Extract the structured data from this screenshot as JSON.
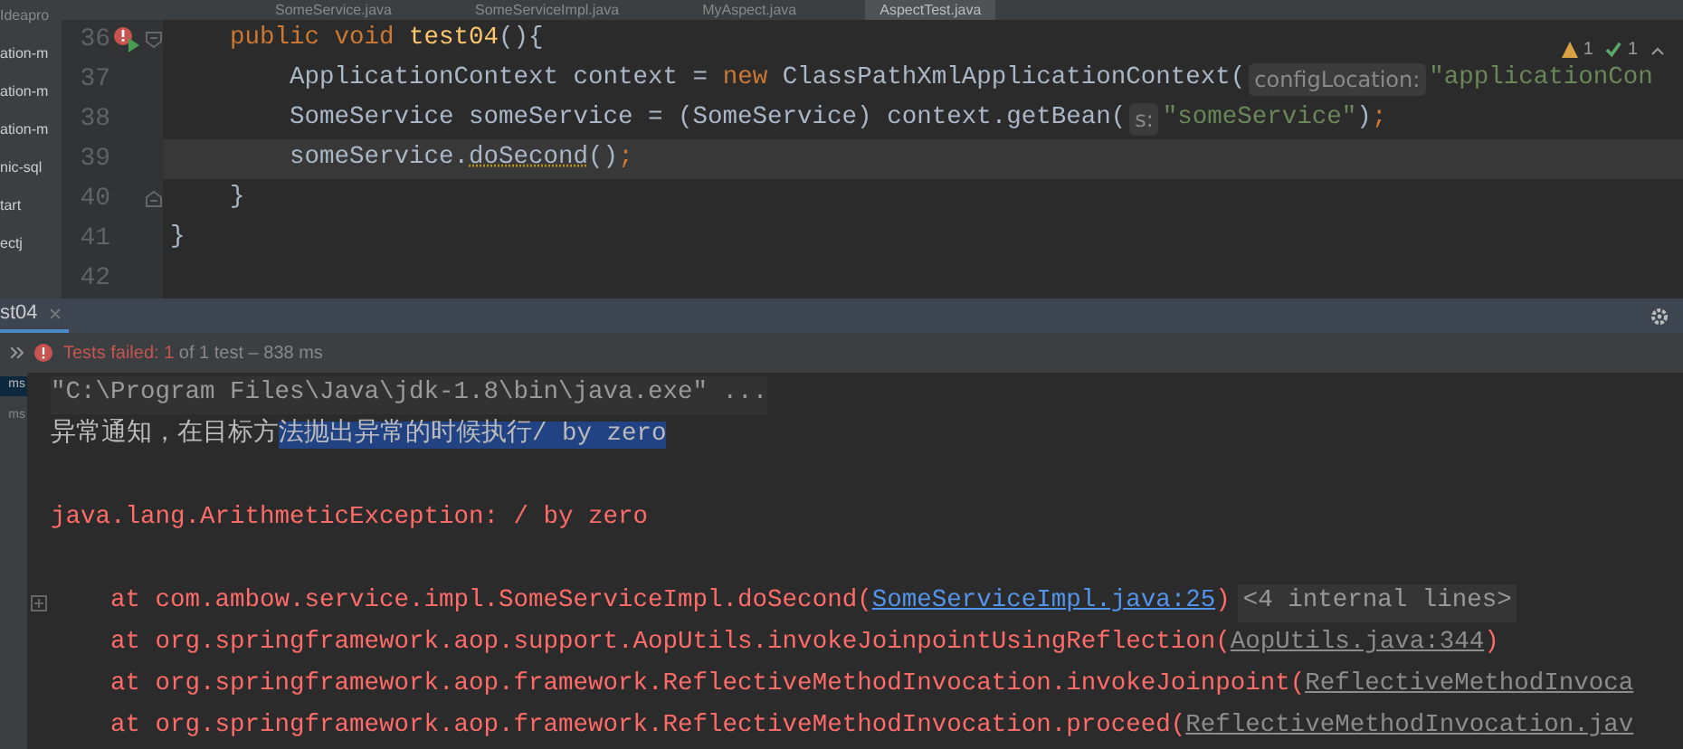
{
  "editor_tabs": [
    {
      "label": "SomeService.java",
      "selected": false
    },
    {
      "label": "SomeServiceImpl.java",
      "selected": false
    },
    {
      "label": "MyAspect.java",
      "selected": false
    },
    {
      "label": "AspectTest.java",
      "selected": true
    }
  ],
  "project_tree": [
    "Ideapro",
    "ation-m",
    "ation-m",
    "ation-m",
    "nic-sql",
    "tart",
    "ectj"
  ],
  "inspections": {
    "warnings": "1",
    "passed": "1"
  },
  "code_lines": [
    {
      "number": "36",
      "current": false,
      "run_icon": true,
      "fold_open": true,
      "fold_close": false,
      "tokens": [
        {
          "kind": "kw",
          "text": "    public void "
        },
        {
          "kind": "fn",
          "text": "test04"
        },
        {
          "kind": "plain",
          "text": "(){"
        }
      ]
    },
    {
      "number": "37",
      "current": false,
      "run_icon": false,
      "fold_open": false,
      "fold_close": false,
      "tokens": [
        {
          "kind": "plain",
          "text": "        ApplicationContext context = "
        },
        {
          "kind": "kw",
          "text": "new "
        },
        {
          "kind": "plain",
          "text": "ClassPathXmlApplicationContext("
        },
        {
          "kind": "hint",
          "text": "configLocation:"
        },
        {
          "kind": "str",
          "text": "\"applicationCon"
        }
      ]
    },
    {
      "number": "38",
      "current": false,
      "run_icon": false,
      "fold_open": false,
      "fold_close": false,
      "tokens": [
        {
          "kind": "plain",
          "text": "        SomeService someService = (SomeService) context.getBean("
        },
        {
          "kind": "hint",
          "text": "s:"
        },
        {
          "kind": "str",
          "text": "\"someService\""
        },
        {
          "kind": "plain",
          "text": ")"
        },
        {
          "kind": "kw",
          "text": ";"
        }
      ]
    },
    {
      "number": "39",
      "current": true,
      "run_icon": false,
      "fold_open": false,
      "fold_close": false,
      "tokens": [
        {
          "kind": "plain",
          "text": "        someService."
        },
        {
          "kind": "warn",
          "text": "doSecond"
        },
        {
          "kind": "plain",
          "text": "()"
        },
        {
          "kind": "kw",
          "text": ";"
        }
      ]
    },
    {
      "number": "40",
      "current": false,
      "run_icon": false,
      "fold_open": false,
      "fold_close": true,
      "tokens": [
        {
          "kind": "plain",
          "text": "    }"
        }
      ]
    },
    {
      "number": "41",
      "current": false,
      "run_icon": false,
      "fold_open": false,
      "fold_close": false,
      "tokens": [
        {
          "kind": "plain",
          "text": "}"
        }
      ]
    },
    {
      "number": "42",
      "current": false,
      "run_icon": false,
      "fold_open": false,
      "fold_close": false
    }
  ],
  "run_panel": {
    "tab": {
      "label": "st04",
      "selected": true
    },
    "status": {
      "failed_label": "Tests failed: ",
      "failed_count": "1",
      "rest": " of 1 test – 838 ms"
    },
    "side_items": [
      "ms",
      "ms"
    ],
    "console": [
      {
        "kind": "command",
        "text": "\"C:\\Program Files\\Java\\jdk-1.8\\bin\\java.exe\" ..."
      },
      {
        "kind": "output",
        "segments": [
          {
            "text": "异常通知，在目标方",
            "selected": false
          },
          {
            "text": "法抛出异常的时候执行/ by zero",
            "selected": true
          }
        ]
      },
      {
        "kind": "blank"
      },
      {
        "kind": "error",
        "text": "java.lang.ArithmeticException: / by zero"
      },
      {
        "kind": "blank"
      },
      {
        "kind": "frame",
        "expandable": true,
        "text": "at com.ambow.service.impl.SomeServiceImpl.doSecond(",
        "link": "SomeServiceImpl.java:25",
        "project_link": true,
        "after": ")",
        "note": "<4 internal lines>"
      },
      {
        "kind": "frame",
        "expandable": false,
        "text": "at org.springframework.aop.support.AopUtils.invokeJoinpointUsingReflection(",
        "link": "AopUtils.java:344",
        "project_link": false,
        "after": ")"
      },
      {
        "kind": "frame",
        "expandable": false,
        "text": "at org.springframework.aop.framework.ReflectiveMethodInvocation.invokeJoinpoint(",
        "link": "ReflectiveMethodInvoca",
        "project_link": false
      },
      {
        "kind": "frame",
        "expandable": false,
        "text": "at org.springframework.aop.framework.ReflectiveMethodInvocation.proceed(",
        "link": "ReflectiveMethodInvocation.jav",
        "project_link": false
      }
    ]
  }
}
